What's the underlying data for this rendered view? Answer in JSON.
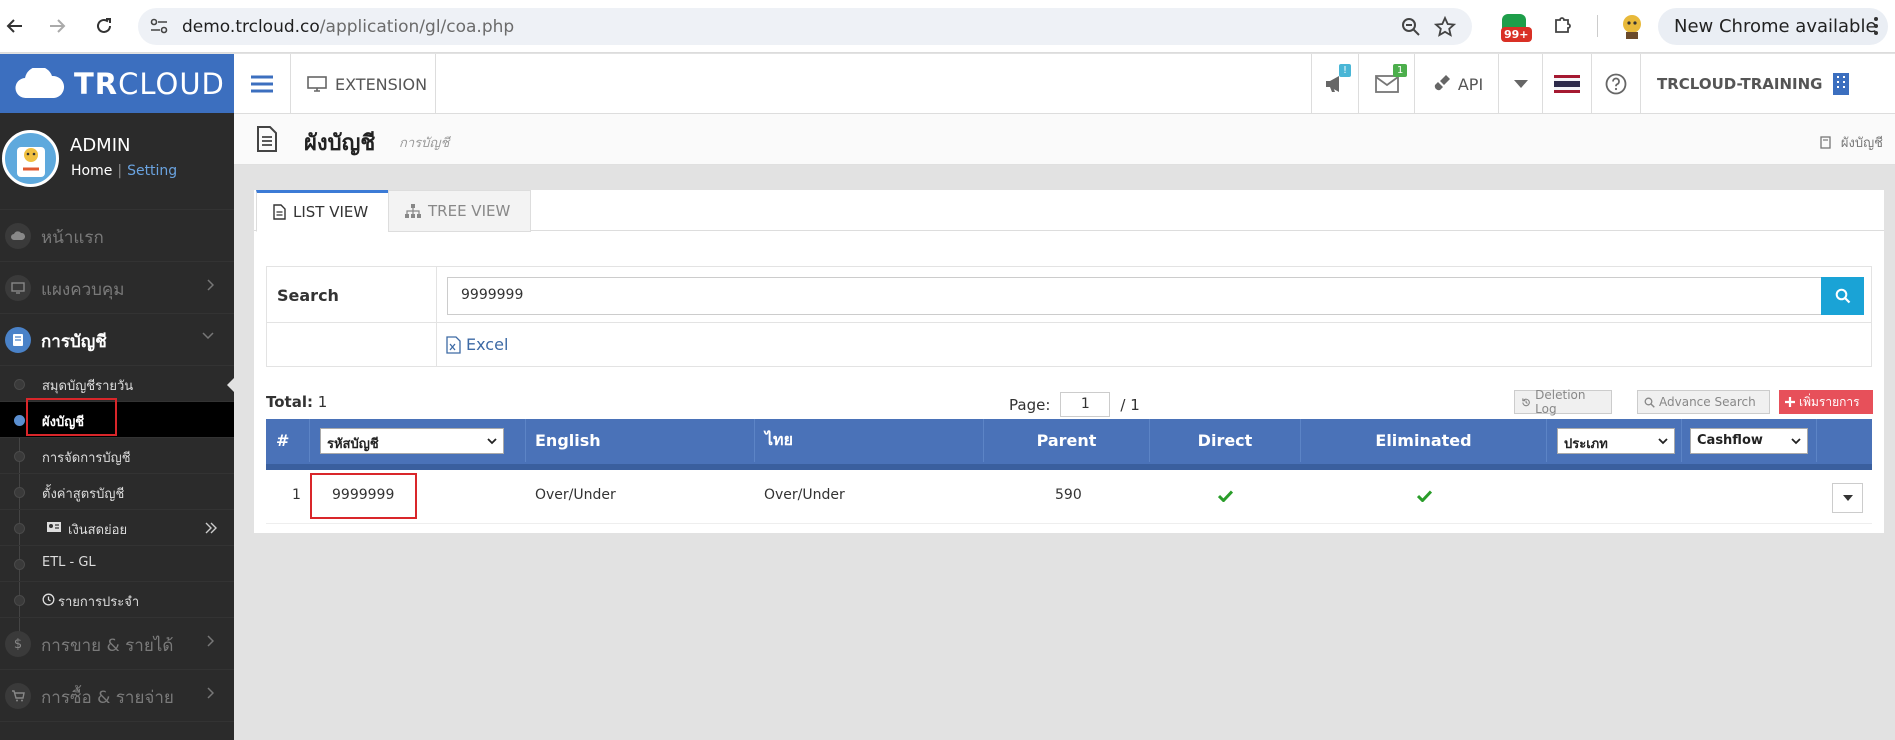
{
  "browser": {
    "url_domain": "demo.trcloud.co",
    "url_path": "/application/gl/coa.php",
    "extension_count": "99+",
    "update_label": "New Chrome available"
  },
  "sidebar": {
    "logo_bold": "TR",
    "logo_light": "CLOUD",
    "user_name": "ADMIN",
    "home_link": "Home",
    "setting_link": "Setting",
    "menu": {
      "home": "หน้าแรก",
      "dashboard": "แผงควบคุม",
      "accounting": "การบัญชี",
      "sales": "การขาย & รายได้",
      "purchases": "การซื้อ & รายจ่าย"
    },
    "submenu": {
      "journal": "สมุดบัญชีรายวัน",
      "coa": "ผังบัญชี",
      "account_mgmt": "การจัดการบัญชี",
      "formula": "ตั้งค่าสูตรบัญชี",
      "petty_cash": "เงินสดย่อย",
      "etl": "ETL - GL",
      "recurring": "รายการประจำ"
    }
  },
  "topbar": {
    "extension": "EXTENSION",
    "announce_badge": "!",
    "mail_badge": "1",
    "api": "API",
    "company": "TRCLOUD-TRAINING"
  },
  "page": {
    "title": "ผังบัญชี",
    "subtitle": "การบัญชี",
    "breadcrumb": "ผังบัญชี"
  },
  "tabs": {
    "list": "LIST VIEW",
    "tree": "TREE VIEW"
  },
  "search": {
    "label": "Search",
    "value": "9999999",
    "excel": "Excel"
  },
  "summary": {
    "total_label": "Total:",
    "total_value": "1",
    "page_label": "Page:",
    "page_current": "1",
    "page_total": "/ 1",
    "deletion_log": "Deletion Log",
    "advance_search": "Advance Search",
    "add_item": "เพิ่มรายการ"
  },
  "table": {
    "columns": {
      "num": "#",
      "code_select": "รหัสบัญชี",
      "english": "English",
      "thai": "ไทย",
      "parent": "Parent",
      "direct": "Direct",
      "eliminated": "Eliminated",
      "type_select": "ประเภท",
      "cashflow_select": "Cashflow"
    },
    "rows": [
      {
        "num": "1",
        "code": "9999999",
        "english": "Over/Under",
        "thai": "Over/Under",
        "parent": "590",
        "direct": true,
        "eliminated": true
      }
    ]
  },
  "colors": {
    "brand_blue": "#3c6fbf",
    "table_header": "#4a72b8",
    "search_button": "#1aa3d6",
    "add_button": "#e7505a",
    "check_green": "#2a9d2a",
    "highlight_red": "#d9262a"
  },
  "icons": {
    "refresh": "refresh-icon",
    "search": "search-icon",
    "check": "check-icon",
    "excel": "excel-file-icon"
  }
}
